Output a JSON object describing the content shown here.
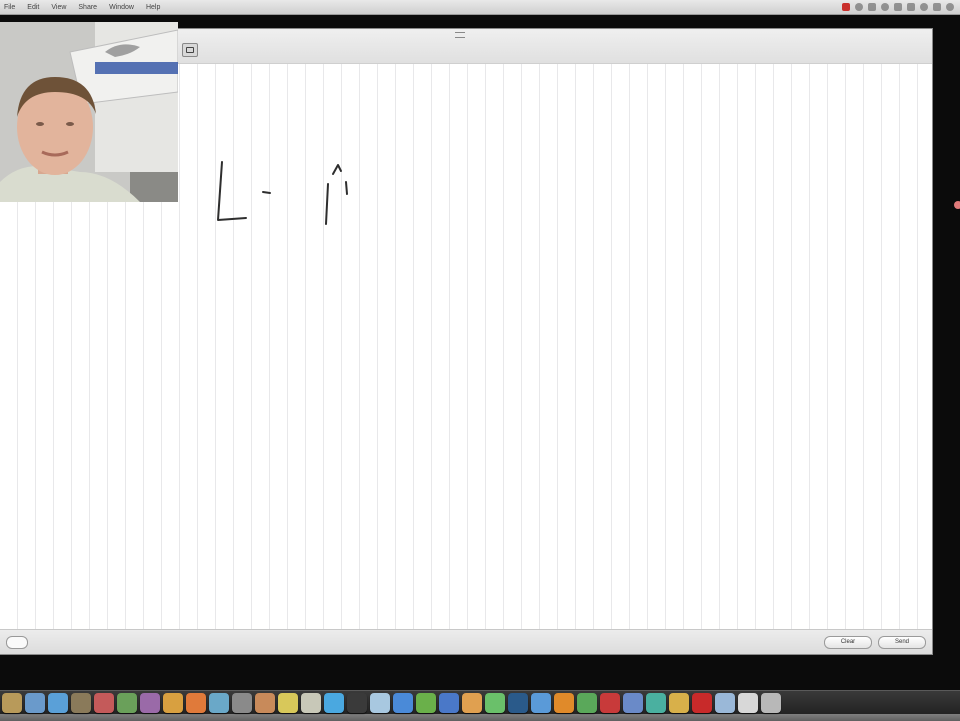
{
  "menubar": {
    "items": [
      "File",
      "Edit",
      "View",
      "Share",
      "Window",
      "Help"
    ],
    "status_icons": [
      "recording-indicator-icon",
      "wifi-icon",
      "bluetooth-icon",
      "time-machine-icon",
      "volume-icon",
      "battery-icon",
      "clock-icon",
      "user-icon",
      "spotlight-icon"
    ]
  },
  "window": {
    "toolbar_icon": "photo-capture-icon",
    "ink_strokes": [
      "M 222 126 L 218 184 L 246 182",
      "M 263 156 L 270 157",
      "M 328 148 L 326 188",
      "M 333 138 L 338 129 L 341 135",
      "M 346 146 L 347 158"
    ],
    "clear_label": "Clear",
    "send_label": "Send"
  },
  "webcam": {
    "description_icon": "webcam-video-feed"
  },
  "dock": {
    "icons": [
      {
        "name": "finder-icon",
        "color": "#b89a5a"
      },
      {
        "name": "launchpad-icon",
        "color": "#6a9acb"
      },
      {
        "name": "safari-icon",
        "color": "#5aa0d8"
      },
      {
        "name": "mail-icon",
        "color": "#8a7a5a"
      },
      {
        "name": "address-book-icon",
        "color": "#c45a5a"
      },
      {
        "name": "calendar-icon",
        "color": "#6aa05a"
      },
      {
        "name": "photo-booth-icon",
        "color": "#9a6aa8"
      },
      {
        "name": "chrome-icon",
        "color": "#d8a040"
      },
      {
        "name": "firefox-icon",
        "color": "#e07a3a"
      },
      {
        "name": "itunes-icon",
        "color": "#6aa8c8"
      },
      {
        "name": "system-preferences-icon",
        "color": "#8a8a8a"
      },
      {
        "name": "preview-icon",
        "color": "#c88a5a"
      },
      {
        "name": "notes-icon",
        "color": "#d8c85a"
      },
      {
        "name": "textedit-icon",
        "color": "#c8c8b8"
      },
      {
        "name": "skype-icon",
        "color": "#4aa8e0"
      },
      {
        "name": "terminal-icon",
        "color": "#3a3a3a"
      },
      {
        "name": "folder-icon",
        "color": "#a8c8e0"
      },
      {
        "name": "dropbox-icon",
        "color": "#4a8ad8"
      },
      {
        "name": "evernote-icon",
        "color": "#6ab04a"
      },
      {
        "name": "keynote-icon",
        "color": "#4a78c8"
      },
      {
        "name": "pages-icon",
        "color": "#e0a050"
      },
      {
        "name": "numbers-icon",
        "color": "#6ac06a"
      },
      {
        "name": "photoshop-icon",
        "color": "#2a5a8a"
      },
      {
        "name": "app-store-icon",
        "color": "#5a9ad8"
      },
      {
        "name": "vlc-icon",
        "color": "#e08a2a"
      },
      {
        "name": "facetime-icon",
        "color": "#5aa85a"
      },
      {
        "name": "filezilla-icon",
        "color": "#c83a3a"
      },
      {
        "name": "ftp-icon",
        "color": "#6a8ac8"
      },
      {
        "name": "camtasia-icon",
        "color": "#4ab0a0"
      },
      {
        "name": "screenflow-icon",
        "color": "#d8b04a"
      },
      {
        "name": "acrobat-icon",
        "color": "#c82a2a"
      },
      {
        "name": "downloads-stack-icon",
        "color": "#9ab8d8"
      },
      {
        "name": "documents-stack-icon",
        "color": "#d8d8d8"
      },
      {
        "name": "trash-icon",
        "color": "#b8b8b8"
      }
    ]
  },
  "colors": {
    "canvas_background": "#ffffff",
    "ink": "#2e2e2e",
    "grid_lines": "#e8e8ea"
  }
}
